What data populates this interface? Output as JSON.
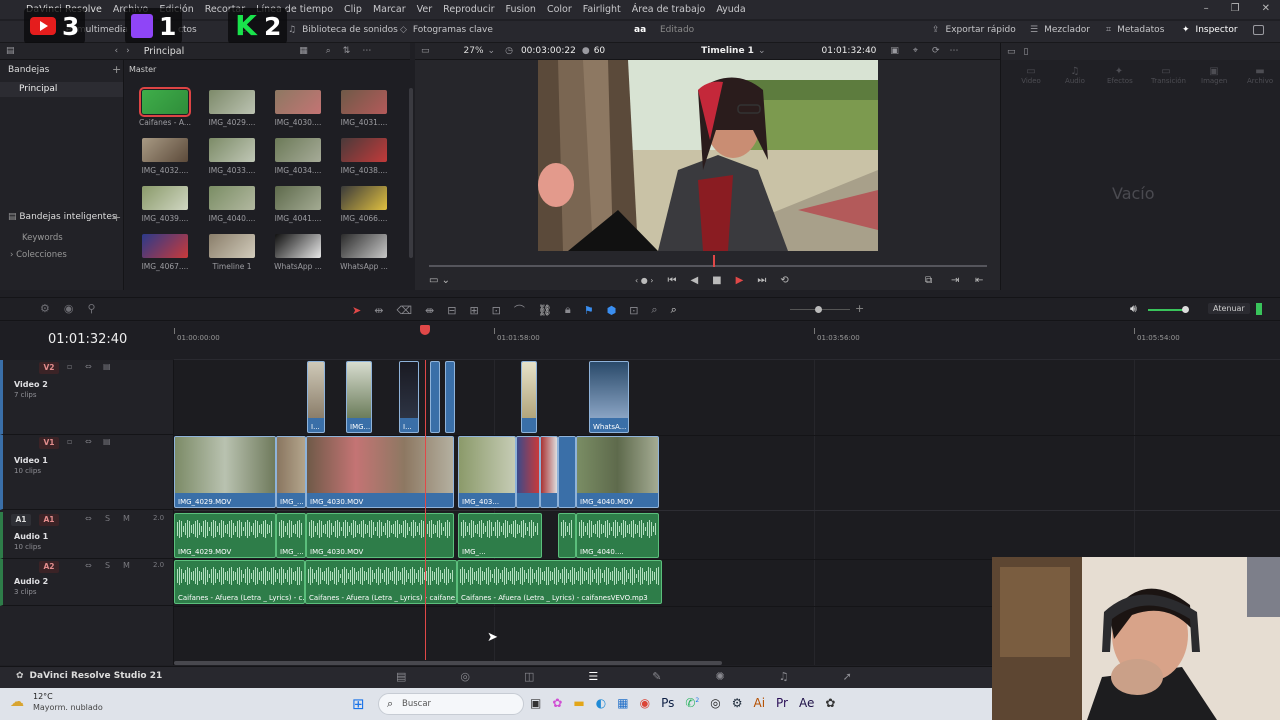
{
  "app": {
    "name": "DaVinci Resolve",
    "menu": [
      "Archivo",
      "Edición",
      "Recortar",
      "Línea de tiempo",
      "Clip",
      "Marcar",
      "Ver",
      "Reproducir",
      "Fusion",
      "Color",
      "Fairlight",
      "Área de trabajo",
      "Ayuda"
    ]
  },
  "overlays": {
    "youtube_count": "3",
    "twitch_count": "1",
    "kick_count": "2"
  },
  "toolbar2": {
    "media": "el multimedia",
    "cortes": "ctos",
    "biblioteca": "Biblioteca de sonidos",
    "fotogramas": "Fotogramas clave",
    "project_mark": "aa",
    "status": "Editado",
    "exportar": "Exportar rápido",
    "mezclador": "Mezclador",
    "metadatos": "Metadatos",
    "inspector": "Inspector"
  },
  "media_pool": {
    "principal": "Principal",
    "bandejas": "Bandejas",
    "bin_principal": "Principal",
    "master": "Master",
    "smart_bins": "Bandejas inteligentes",
    "keywords": "Keywords",
    "colecciones": "Colecciones",
    "clips": [
      "Caifanes - A...",
      "IMG_4029....",
      "IMG_4030....",
      "IMG_4031....",
      "IMG_4032....",
      "IMG_4033....",
      "IMG_4034....",
      "IMG_4038....",
      "IMG_4039....",
      "IMG_4040....",
      "IMG_4041....",
      "IMG_4066....",
      "IMG_4067....",
      "Timeline 1",
      "WhatsApp ...",
      "WhatsApp ..."
    ]
  },
  "viewer": {
    "zoom": "27%",
    "duration": "00:03:00:22",
    "fps": "60",
    "timeline_name": "Timeline 1",
    "timecode": "01:01:32:40"
  },
  "inspector": {
    "tabs": [
      "Video",
      "Audio",
      "Efectos",
      "Transición",
      "Imagen",
      "Archivo"
    ],
    "empty": "Vacío"
  },
  "edit_tools": {
    "atenuar": "Atenuar"
  },
  "timeline": {
    "timecode": "01:01:32:40",
    "ruler": [
      "01:00:00:00",
      "01:01:58:00",
      "01:03:56:00",
      "01:05:54:00"
    ],
    "tracks": [
      {
        "id": "V2",
        "name": "Video 2",
        "count": "7 clips"
      },
      {
        "id": "V1",
        "name": "Video 1",
        "count": "10 clips"
      },
      {
        "id": "A1",
        "name": "Audio 1",
        "count": "10 clips",
        "level": "2.0"
      },
      {
        "id": "A2",
        "name": "Audio 2",
        "count": "3 clips",
        "level": "2.0"
      }
    ],
    "v2_labels": [
      "I...",
      "IMG...",
      "I...",
      "WhatsA..."
    ],
    "v1_labels": [
      "IMG_4029.MOV",
      "IMG_...",
      "IMG_4030.MOV",
      "IMG_403...",
      "IMG_4040.MOV"
    ],
    "a1_labels": [
      "IMG_4029.MOV",
      "IMG_...",
      "IMG_4030.MOV",
      "IMG_...",
      "IMG_4040...."
    ],
    "a2_labels": [
      "Caifanes - Afuera (Letra _ Lyrics) - c...",
      "Caifanes - Afuera (Letra _ Lyrics) - caifane...",
      "Caifanes - Afuera (Letra _ Lyrics) - caifanesVEVO.mp3"
    ]
  },
  "page_bar": {
    "product": "DaVinci Resolve Studio 21"
  },
  "taskbar": {
    "temp": "12°C",
    "weather": "Mayorm. nublado",
    "search": "Buscar",
    "badge": "2"
  },
  "colors": {
    "accent_red": "#e04848",
    "video_clip": "#3a6fa8",
    "audio_clip": "#2e7d49"
  }
}
